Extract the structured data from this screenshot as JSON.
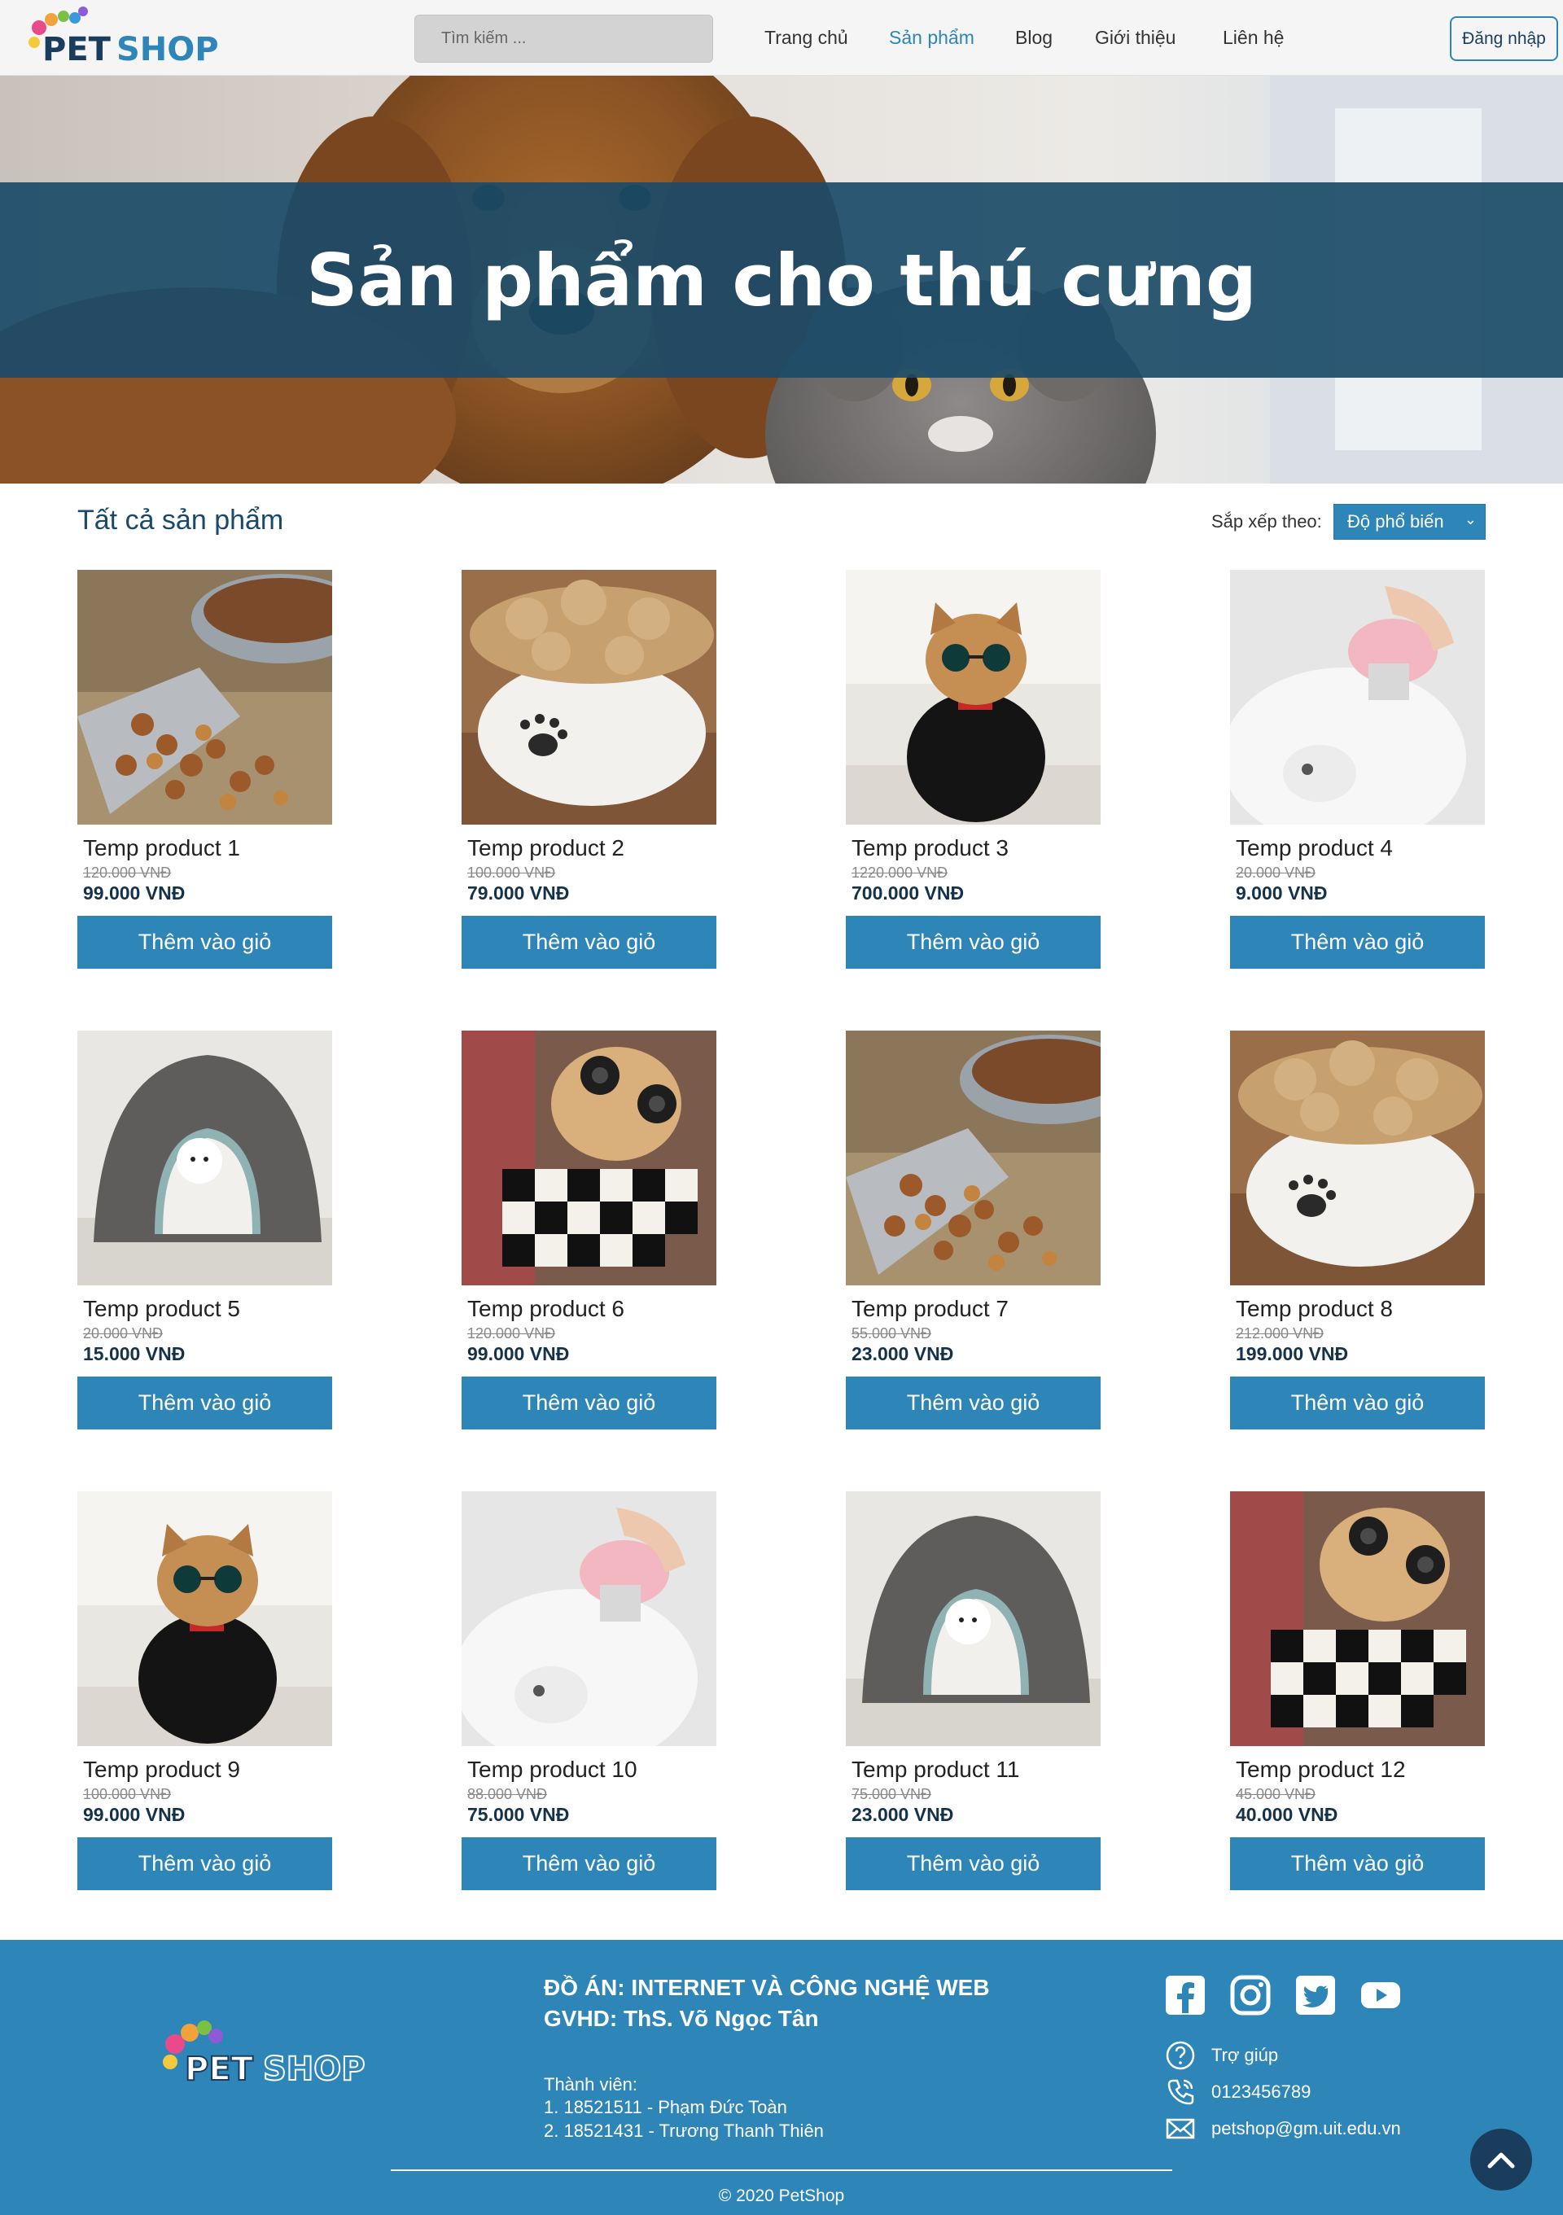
{
  "header": {
    "brand": "PETSHOP",
    "search_placeholder": "Tìm kiếm ...",
    "nav": [
      "Trang chủ",
      "Sản phẩm",
      "Blog",
      "Giới thiệu",
      "Liên hệ"
    ],
    "active_nav": "Sản phẩm",
    "login_label": "Đăng nhập"
  },
  "hero": {
    "title": "Sản phẩm cho thú cưng"
  },
  "products_section": {
    "title": "Tất cả sản phẩm",
    "sort_label": "Sắp xếp theo:",
    "sort_value": "Độ phổ biến"
  },
  "products": [
    {
      "name": "Temp product 1",
      "old_price": "120.000 VNĐ",
      "price": "99.000 VNĐ",
      "button": "Thêm vào giỏ",
      "image": "pet-food-scoop"
    },
    {
      "name": "Temp product 2",
      "old_price": "100.000 VNĐ",
      "price": "79.000 VNĐ",
      "button": "Thêm vào giỏ",
      "image": "pet-treat-bowl"
    },
    {
      "name": "Temp product 3",
      "old_price": "1220.000 VNĐ",
      "price": "700.000 VNĐ",
      "button": "Thêm vào giỏ",
      "image": "cat-black-hoodie"
    },
    {
      "name": "Temp product 4",
      "old_price": "20.000 VNĐ",
      "price": "9.000 VNĐ",
      "button": "Thêm vào giỏ",
      "image": "cat-grooming-brush"
    },
    {
      "name": "Temp product 5",
      "old_price": "20.000 VNĐ",
      "price": "15.000 VNĐ",
      "button": "Thêm vào giỏ",
      "image": "dog-pet-house"
    },
    {
      "name": "Temp product 6",
      "old_price": "120.000 VNĐ",
      "price": "99.000 VNĐ",
      "button": "Thêm vào giỏ",
      "image": "cat-checkered-hoodie"
    },
    {
      "name": "Temp product 7",
      "old_price": "55.000 VNĐ",
      "price": "23.000 VNĐ",
      "button": "Thêm vào giỏ",
      "image": "pet-food-scoop"
    },
    {
      "name": "Temp product 8",
      "old_price": "212.000 VNĐ",
      "price": "199.000 VNĐ",
      "button": "Thêm vào giỏ",
      "image": "pet-treat-bowl"
    },
    {
      "name": "Temp product 9",
      "old_price": "100.000 VNĐ",
      "price": "99.000 VNĐ",
      "button": "Thêm vào giỏ",
      "image": "cat-black-hoodie"
    },
    {
      "name": "Temp product 10",
      "old_price": "88.000 VNĐ",
      "price": "75.000 VNĐ",
      "button": "Thêm vào giỏ",
      "image": "cat-grooming-brush"
    },
    {
      "name": "Temp product 11",
      "old_price": "75.000 VNĐ",
      "price": "23.000 VNĐ",
      "button": "Thêm vào giỏ",
      "image": "dog-pet-house"
    },
    {
      "name": "Temp product 12",
      "old_price": "45.000 VNĐ",
      "price": "40.000 VNĐ",
      "button": "Thêm vào giỏ",
      "image": "cat-checkered-hoodie"
    }
  ],
  "footer": {
    "project_line1": "ĐỒ ÁN: INTERNET VÀ CÔNG NGHỆ WEB",
    "project_line2": "GVHD: ThS. Võ Ngọc Tân",
    "members_label": "Thành viên:",
    "members": [
      "1. 18521511 - Phạm Đức Toàn",
      "2. 18521431 - Trương Thanh Thiên"
    ],
    "social": [
      "facebook-icon",
      "instagram-icon",
      "twitter-icon",
      "youtube-icon"
    ],
    "help": "Trợ giúp",
    "phone": "0123456789",
    "email": "petshop@gm.uit.edu.vn",
    "copyright": "© 2020 PetShop"
  },
  "colors": {
    "primary": "#2e85b8",
    "dark": "#1a3d5d",
    "hero_band": "#1b4b68"
  }
}
